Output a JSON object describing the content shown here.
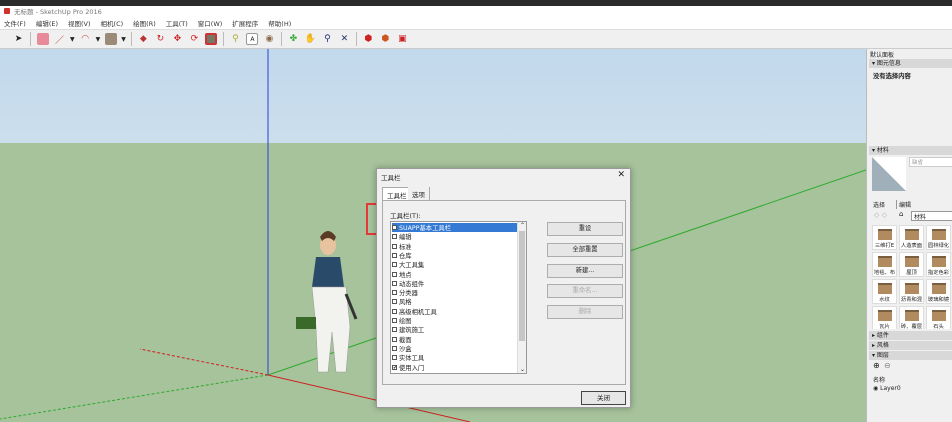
{
  "window": {
    "title": "无标题 - SketchUp Pro 2016"
  },
  "menu": [
    "文件(F)",
    "编辑(E)",
    "视图(V)",
    "相机(C)",
    "绘图(R)",
    "工具(T)",
    "窗口(W)",
    "扩展程序",
    "帮助(H)"
  ],
  "dialog": {
    "title": "工具栏",
    "close": "✕",
    "tabs": [
      "工具栏",
      "选项"
    ],
    "list_label": "工具栏(T):",
    "items": [
      {
        "label": "SUAPP基本工具栏",
        "checked": false,
        "selected": true
      },
      {
        "label": "编辑",
        "checked": false
      },
      {
        "label": "标准",
        "checked": false
      },
      {
        "label": "仓库",
        "checked": false
      },
      {
        "label": "大工具集",
        "checked": false
      },
      {
        "label": "地点",
        "checked": false
      },
      {
        "label": "动态组件",
        "checked": false
      },
      {
        "label": "分类器",
        "checked": false
      },
      {
        "label": "风格",
        "checked": false
      },
      {
        "label": "高级相机工具",
        "checked": false
      },
      {
        "label": "绘图",
        "checked": false
      },
      {
        "label": "建筑施工",
        "checked": false
      },
      {
        "label": "截面",
        "checked": false
      },
      {
        "label": "沙盒",
        "checked": false
      },
      {
        "label": "实体工具",
        "checked": false
      },
      {
        "label": "使用入门",
        "checked": true
      }
    ],
    "buttons": {
      "reset": "重设",
      "reset_all": "全部重置",
      "new": "新建...",
      "rename": "重命名...",
      "delete": "删除",
      "close": "关闭"
    }
  },
  "tray": {
    "title": "默认面板",
    "entity_info": {
      "header": "图元信息",
      "empty": "没有选择内容"
    },
    "materials": {
      "header": "材料",
      "default": "缺省",
      "tabs": [
        "选择",
        "编辑"
      ],
      "category": "材料",
      "swatches": [
        "三维打E",
        "人造表面",
        "园林绿化",
        "地毯、布",
        "屋顶",
        "指定色彩",
        "水纹",
        "沥青和混",
        "玻璃和镜",
        "瓦片",
        "砖、覆层",
        "石头"
      ]
    },
    "components": "组件",
    "styles": "风格",
    "layers": {
      "header": "图层",
      "col_name": "名称",
      "layer": "Layer0"
    }
  },
  "colors": {
    "accent": "#3479d3",
    "highlight": "#e53935",
    "ground": "#a6c39c",
    "sky": "#c2d9ec"
  }
}
